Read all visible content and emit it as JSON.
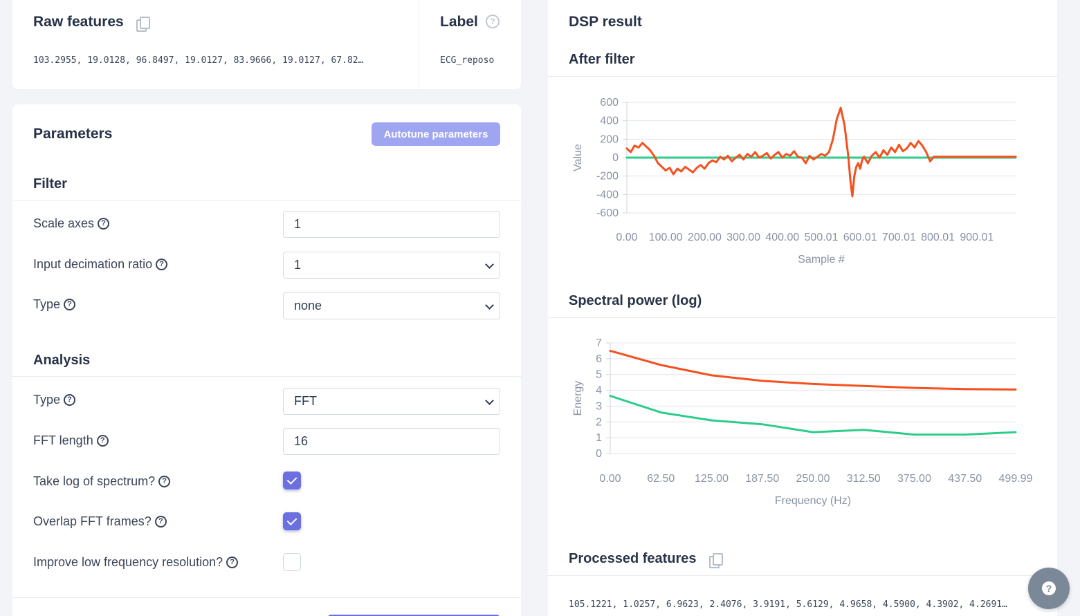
{
  "raw": {
    "title": "Raw features",
    "values": "103.2955, 19.0128, 96.8497, 19.0127, 83.9666, 19.0127, 67.82…",
    "label_title": "Label",
    "label_value": "ECG_reposo"
  },
  "params": {
    "title": "Parameters",
    "autotune": "Autotune parameters",
    "filter": {
      "title": "Filter",
      "scale_axes_label": "Scale axes",
      "scale_axes_value": "1",
      "decimation_label": "Input decimation ratio",
      "decimation_value": "1",
      "type_label": "Type",
      "type_value": "none"
    },
    "analysis": {
      "title": "Analysis",
      "type_label": "Type",
      "type_value": "FFT",
      "fft_length_label": "FFT length",
      "fft_length_value": "16",
      "log_label": "Take log of spectrum?",
      "log_checked": true,
      "overlap_label": "Overlap FFT frames?",
      "overlap_checked": true,
      "lowfreq_label": "Improve low frequency resolution?",
      "lowfreq_checked": false
    }
  },
  "dsp": {
    "title": "DSP result",
    "after_filter_title": "After filter",
    "spectral_title": "Spectral power (log)",
    "processed_title": "Processed features",
    "processed_values": "105.1221, 1.0257, 6.9623, 2.4076, 3.9191, 5.6129, 4.9658, 4.5900, 4.3902, 4.2691…"
  },
  "colors": {
    "accent": "#6c6fe0",
    "series_orange": "#f4511e",
    "series_green": "#2ecc8a"
  },
  "chart_data": [
    {
      "type": "line",
      "xlabel": "Sample #",
      "ylabel": "Value",
      "xlim": [
        0,
        1000
      ],
      "ylim": [
        -600,
        600
      ],
      "x_ticks": [
        "0.00",
        "100.00",
        "200.00",
        "300.00",
        "400.00",
        "500.01",
        "600.01",
        "700.01",
        "800.01",
        "900.01"
      ],
      "y_ticks": [
        "600",
        "400",
        "200",
        "0",
        "-200",
        "-400",
        "-600"
      ],
      "grid": true,
      "series": [
        {
          "color": "#f4511e",
          "x": [
            0,
            10,
            20,
            30,
            40,
            50,
            60,
            70,
            80,
            90,
            100,
            110,
            120,
            130,
            140,
            150,
            160,
            170,
            180,
            190,
            200,
            210,
            220,
            230,
            240,
            250,
            260,
            270,
            280,
            290,
            300,
            310,
            320,
            330,
            340,
            350,
            360,
            370,
            380,
            390,
            400,
            410,
            420,
            430,
            440,
            450,
            460,
            470,
            480,
            490,
            500,
            510,
            520,
            530,
            540,
            550,
            560,
            570,
            575,
            580,
            585,
            590,
            595,
            600,
            605,
            610,
            620,
            630,
            640,
            650,
            660,
            670,
            680,
            690,
            700,
            710,
            720,
            730,
            740,
            750,
            760,
            770,
            780,
            790,
            800,
            810,
            820,
            830,
            840,
            850,
            860,
            870,
            880,
            900,
            950,
            1000
          ],
          "y": [
            100,
            60,
            130,
            110,
            160,
            120,
            80,
            20,
            -60,
            -100,
            -140,
            -110,
            -180,
            -120,
            -150,
            -100,
            -130,
            -160,
            -110,
            -80,
            -120,
            -60,
            -30,
            -50,
            10,
            -20,
            20,
            -40,
            0,
            30,
            -20,
            40,
            10,
            60,
            0,
            20,
            50,
            -10,
            30,
            60,
            0,
            40,
            20,
            70,
            10,
            0,
            -60,
            20,
            -20,
            10,
            40,
            20,
            60,
            200,
            420,
            540,
            350,
            0,
            -250,
            -420,
            -200,
            -100,
            -60,
            -120,
            -30,
            10,
            -60,
            20,
            60,
            0,
            80,
            30,
            110,
            60,
            140,
            70,
            100,
            160,
            110,
            180,
            130,
            60,
            -40,
            10,
            10,
            10,
            10,
            10,
            10,
            10,
            10,
            10,
            10,
            10,
            10,
            10
          ]
        },
        {
          "color": "#2ecc8a",
          "x": [
            0,
            1000
          ],
          "y": [
            0,
            0
          ]
        }
      ]
    },
    {
      "type": "line",
      "xlabel": "Frequency (Hz)",
      "ylabel": "Energy",
      "xlim": [
        0,
        499.99
      ],
      "ylim": [
        0,
        7
      ],
      "x_ticks": [
        "0.00",
        "62.50",
        "125.00",
        "187.50",
        "250.00",
        "312.50",
        "375.00",
        "437.50",
        "499.99"
      ],
      "y_ticks": [
        "7",
        "6",
        "5",
        "4",
        "3",
        "2",
        "1",
        "0"
      ],
      "grid": true,
      "series": [
        {
          "color": "#f4511e",
          "x": [
            0,
            62.5,
            125,
            187.5,
            250,
            312.5,
            375,
            437.5,
            499.99
          ],
          "y": [
            6.5,
            5.6,
            4.95,
            4.6,
            4.4,
            4.28,
            4.15,
            4.08,
            4.05
          ]
        },
        {
          "color": "#2ecc8a",
          "x": [
            0,
            62.5,
            125,
            187.5,
            250,
            312.5,
            375,
            437.5,
            499.99
          ],
          "y": [
            3.65,
            2.6,
            2.1,
            1.85,
            1.35,
            1.5,
            1.2,
            1.2,
            1.35
          ]
        }
      ]
    }
  ]
}
